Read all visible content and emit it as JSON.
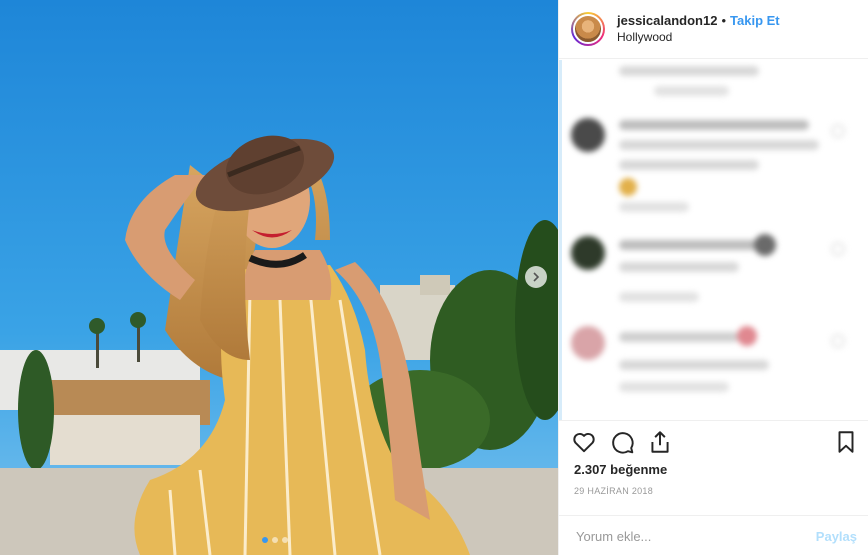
{
  "header": {
    "username": "jessicalandon12",
    "separator": "•",
    "follow_label": "Takip Et",
    "location": "Hollywood"
  },
  "post": {
    "likes": "2.307 beğenme",
    "date": "29 HAZİRAN 2018",
    "carousel_count": 3,
    "carousel_active_index": 0
  },
  "comment_box": {
    "placeholder": "Yorum ekle...",
    "post_label": "Paylaş"
  },
  "icons": [
    "heart-icon",
    "comment-icon",
    "share-icon",
    "bookmark-icon",
    "chevron-right-icon"
  ],
  "colors": {
    "accent": "#3897f0",
    "post_button_disabled": "#b2dffc",
    "text": "#262626",
    "muted": "#999999"
  }
}
